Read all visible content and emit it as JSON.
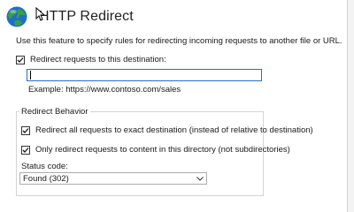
{
  "page": {
    "title": "HTTP Redirect",
    "description": "Use this feature to specify rules for redirecting incoming requests to another file or URL."
  },
  "redirect": {
    "checkbox_label": "Redirect requests to this destination:",
    "checked": true,
    "destination_value": "",
    "example": "Example: https://www.contoso.com/sales"
  },
  "behavior": {
    "group_label": "Redirect Behavior",
    "exact_label": "Redirect all requests to exact destination (instead of relative to destination)",
    "exact_checked": true,
    "only_dir_label": "Only redirect requests to content in this directory (not subdirectories)",
    "only_dir_checked": true,
    "status_label": "Status code:",
    "status_value": "Found (302)"
  },
  "icons": {
    "page_icon": "globe-icon",
    "pointer": "mouse-cursor-icon"
  },
  "colors": {
    "input_focus_border": "#2b6cc8",
    "globe_blue": "#1f6fc5",
    "globe_green": "#3aa042"
  }
}
